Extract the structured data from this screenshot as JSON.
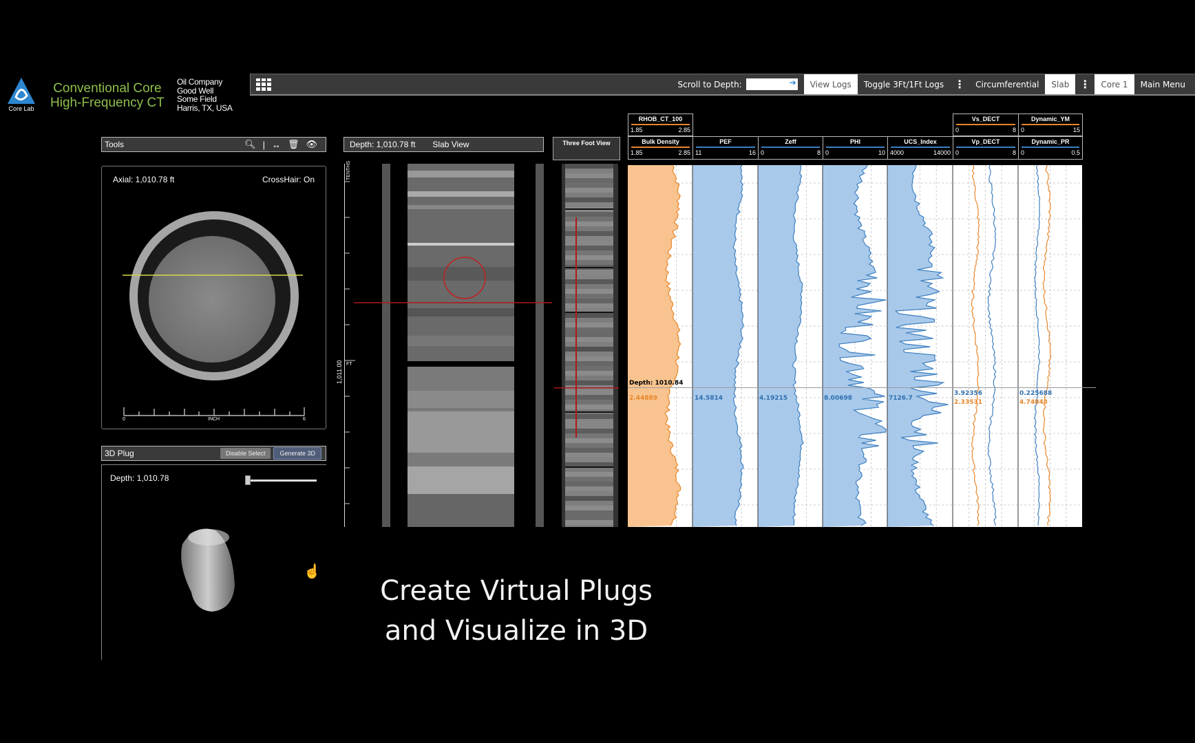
{
  "app": {
    "logo_text": "Core Lab",
    "title_line1": "Conventional Core",
    "title_line2": "High-Frequency CT",
    "well_info": [
      "Oil Company",
      "Good Well",
      "Some Field",
      "Harris, TX, USA"
    ]
  },
  "toolbar": {
    "scroll_label": "Scroll to Depth:",
    "scroll_value": "",
    "view_logs": "View Logs",
    "toggle": "Toggle 3Ft/1Ft Logs",
    "circumferential": "Circumferential",
    "slab": "Slab",
    "core": "Core 1",
    "main_menu": "Main Menu"
  },
  "tools": {
    "title": "Tools"
  },
  "axial": {
    "depth": "Axial: 1,010.78 ft",
    "crosshair": "CrossHair: On",
    "ruler_min": "0",
    "ruler_unit": "INCH",
    "ruler_max": "6"
  },
  "plug": {
    "title": "3D Plug",
    "disable_select": "Disable Select",
    "generate": "Generate 3D",
    "depth": "Depth: 1,010.78"
  },
  "slab": {
    "depth": "Depth: 1,010.78 ft",
    "title": "Slab View",
    "ruler_label": "TENTHS",
    "ruler_depth": "1,011.00",
    "ruler_unit": "FT",
    "three_foot": "Three Foot View"
  },
  "logs": {
    "depth_readout": "Depth: 1010.84",
    "tracks": [
      {
        "name": "RHOB_CT_100",
        "min": "1.85",
        "max": "2.85",
        "color": "#e8862a"
      },
      {
        "name": "Bulk Density",
        "min": "1.85",
        "max": "2.85",
        "color": "#e8862a"
      },
      {
        "name": "PEF",
        "min": "11",
        "max": "16",
        "color": "#3c7fc0"
      },
      {
        "name": "Zeff",
        "min": "0",
        "max": "8",
        "color": "#3c7fc0"
      },
      {
        "name": "PHI",
        "min": "0",
        "max": "10",
        "color": "#3c7fc0"
      },
      {
        "name": "UCS_Index",
        "min": "4000",
        "max": "14000",
        "color": "#3c7fc0"
      },
      {
        "name": "Vs_DECT",
        "min": "0",
        "max": "8",
        "color": "#e8862a"
      },
      {
        "name": "Vp_DECT",
        "min": "0",
        "max": "8",
        "color": "#3c7fc0"
      },
      {
        "name": "Dynamic_YM",
        "min": "0",
        "max": "15",
        "color": "#e8862a"
      },
      {
        "name": "Dynamic_PR",
        "min": "0",
        "max": "0.5",
        "color": "#3c7fc0"
      }
    ],
    "readouts": {
      "rhob": "2.44889",
      "pef": "14.5814",
      "zeff": "4.19215",
      "phi": "8.00698",
      "ucs": "7126.7",
      "vp": "3.92356",
      "vs": "2.33531",
      "pr": "0.225688",
      "ym": "4.74843"
    }
  },
  "caption": {
    "line1": "Create Virtual Plugs",
    "line2": "and Visualize in 3D"
  }
}
